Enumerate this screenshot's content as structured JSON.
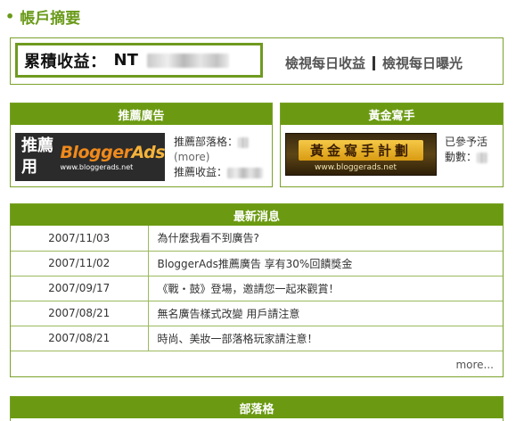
{
  "page": {
    "title": "帳戶摘要"
  },
  "summary": {
    "total_label": "累積收益：",
    "currency": "NT",
    "links": [
      "檢視每日收益",
      "檢視每日曝光"
    ]
  },
  "recommend": {
    "heading": "推薦廣告",
    "banner_text": "推薦用",
    "banner_logo_a": "Blogger",
    "banner_logo_b": "Ads",
    "banner_url": "www.bloggerads.net",
    "blog_label": "推薦部落格：",
    "more": "(more)",
    "income_label": "推薦收益："
  },
  "gold": {
    "heading": "黃金寫手",
    "banner_text": "黃金寫手計劃",
    "banner_url": "www.bloggerads.net",
    "info_line1": "已參予活",
    "info_line2": "動數："
  },
  "news": {
    "heading": "最新消息",
    "rows": [
      {
        "date": "2007/11/03",
        "title": "為什麼我看不到廣告?"
      },
      {
        "date": "2007/11/02",
        "title": "BloggerAds推薦廣告 享有30%回饋獎金"
      },
      {
        "date": "2007/09/17",
        "title": "《戰・鼓》登場，邀請您一起來觀賞！"
      },
      {
        "date": "2007/08/21",
        "title": "無名廣告樣式改變 用戶請注意"
      },
      {
        "date": "2007/08/21",
        "title": "時尚、美妝一部落格玩家請注意！"
      }
    ],
    "more": "more..."
  },
  "blog": {
    "heading": "部落格"
  },
  "colors": {
    "accent": "#6b9a12",
    "border": "#7aa22a"
  }
}
